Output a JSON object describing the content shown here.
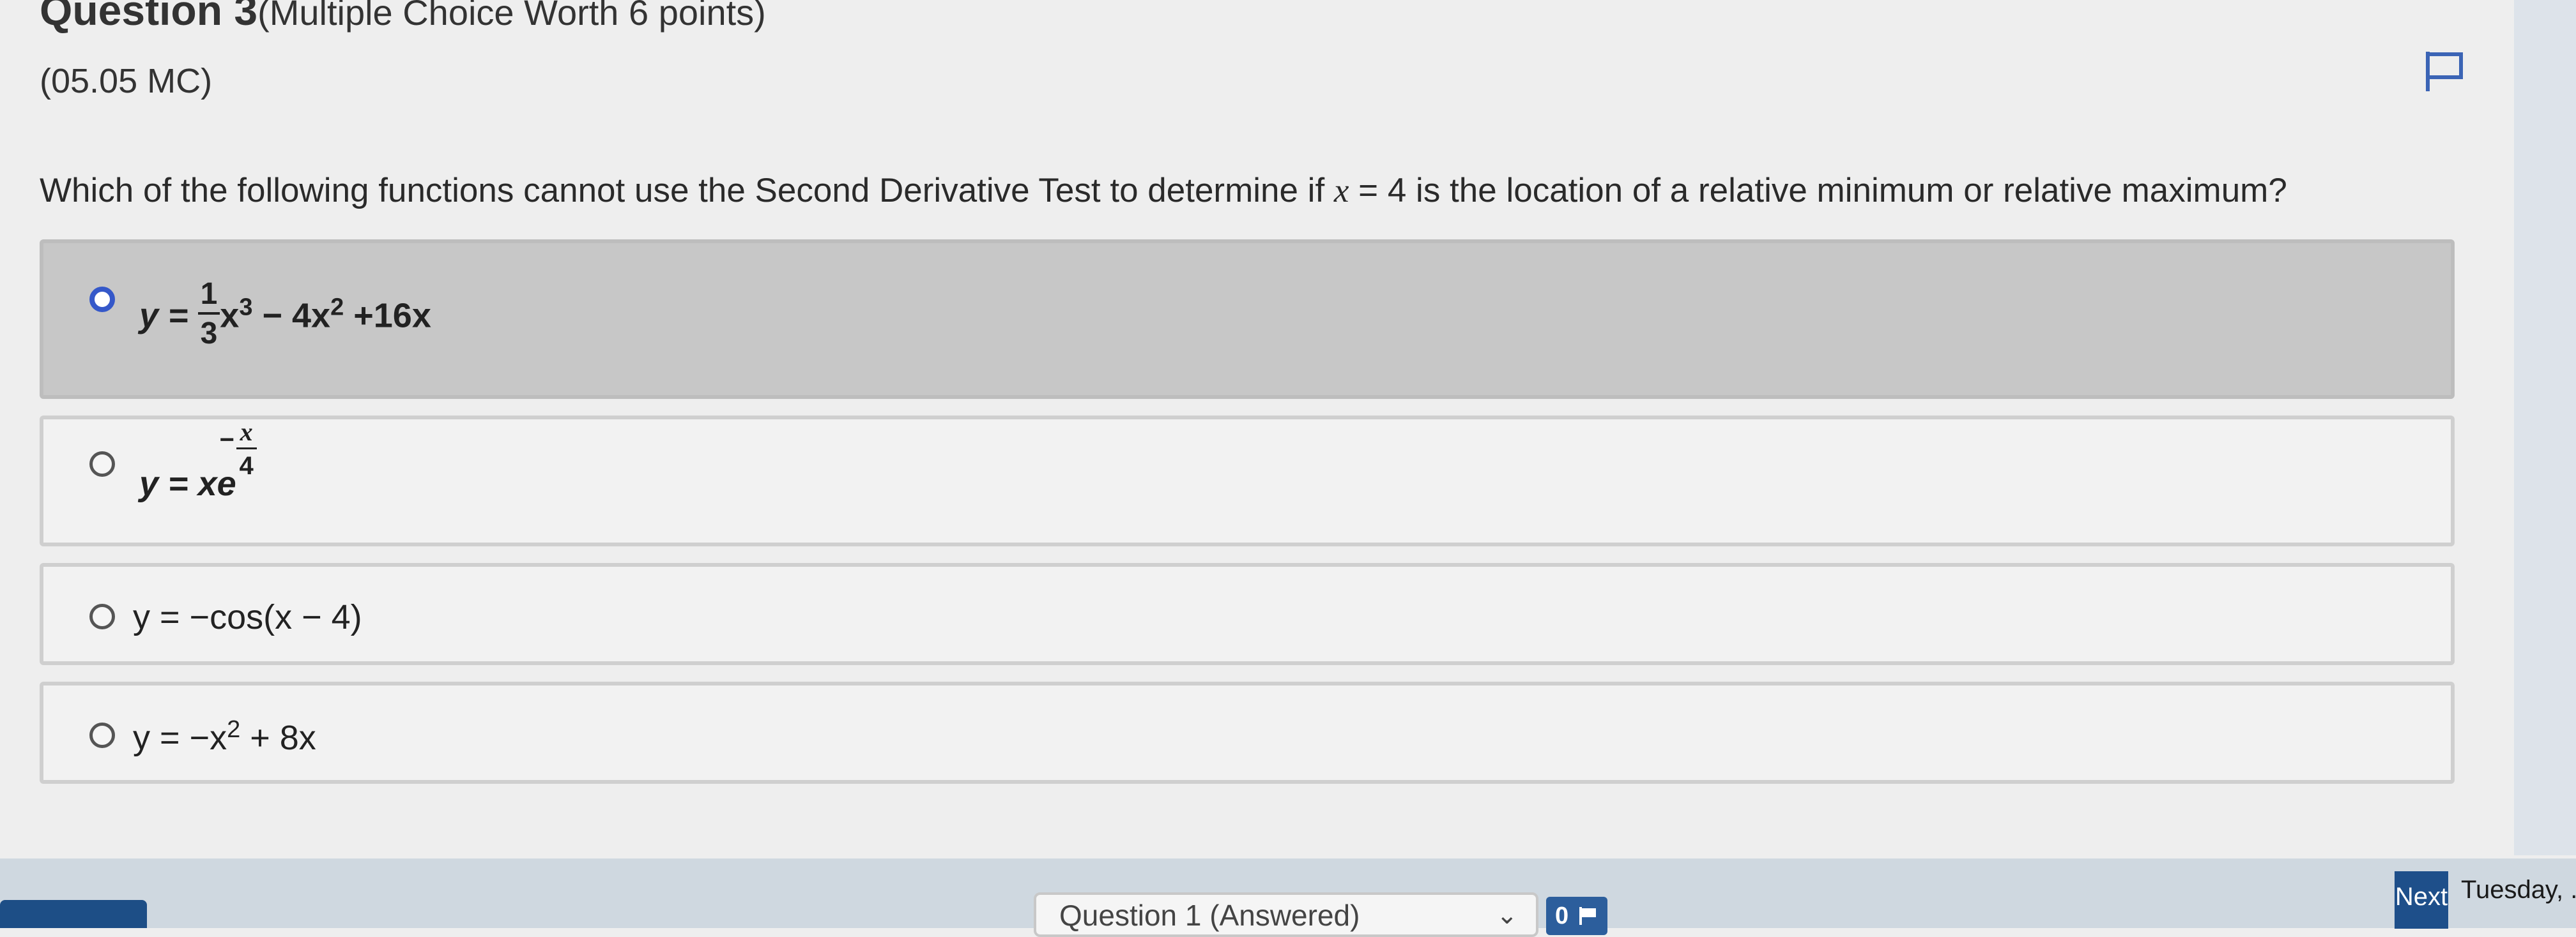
{
  "header": {
    "question_number": "Question 3",
    "points": "(Multiple Choice Worth 6 points)",
    "code": "(05.05 MC)"
  },
  "prompt": {
    "before": "Which of the following functions cannot use the Second Derivative Test to determine if ",
    "var": "x",
    "after": " = 4 is the location of a relative minimum or relative maximum?"
  },
  "choices": [
    {
      "selected": true,
      "text": "y = (1/3)x^3 − 4x^2 + 16x",
      "parts": {
        "lhs": "y =",
        "num": "1",
        "den": "3",
        "x": "x",
        "exp1": "3",
        "mid": " − 4x",
        "exp2": "2",
        "tail": " +16x"
      }
    },
    {
      "selected": false,
      "text": "y = xe^(−x/4)",
      "parts": {
        "lhs": "y = xe",
        "minus": "−",
        "num": "x",
        "den": "4"
      }
    },
    {
      "selected": false,
      "text": "y = −cos(x − 4)"
    },
    {
      "selected": false,
      "text": "y = −x^2 + 8x",
      "parts": {
        "a": "y = −x",
        "exp": "2",
        "b": " + 8x"
      }
    }
  ],
  "footer": {
    "question_select": "Question 1 (Answered)",
    "flag_count": "0",
    "next_label": "Next",
    "date": "Tuesday, ."
  },
  "colors": {
    "selected_radio": "#3558c9",
    "footer_blue": "#1e4f8a"
  },
  "icons": {
    "flag": "flag-icon",
    "dropdown": "chevron-down-icon"
  }
}
